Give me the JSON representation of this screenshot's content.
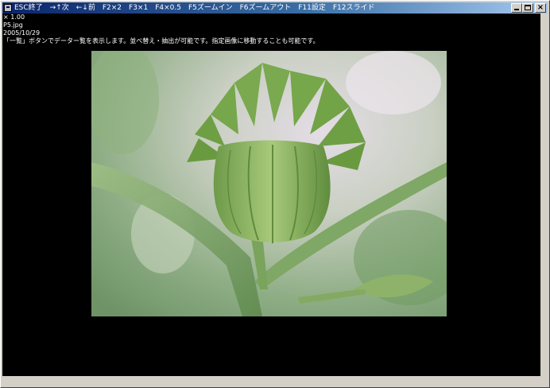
{
  "window": {
    "title": "ESC終了　→↑次　←↓前　F2×2　F3×1　F4×0.5　F5ズームイン　F6ズームアウト　F11設定　F12スライド"
  },
  "viewer": {
    "zoom": "× 1.00",
    "filename": "P5.jpg",
    "date": "2005/10/29",
    "hint": "「一覧」ボタンでデーター覧を表示します。並べ替え・抽出が可能です。指定画像に移動することも可能です。"
  },
  "colors": {
    "titlebar_start": "#0a246a",
    "titlebar_end": "#a6caf0",
    "background": "#000000",
    "text": "#ffffff"
  },
  "icons": {
    "app": "viewer-app-icon",
    "minimize": "minimize-icon",
    "maximize": "maximize-icon",
    "close": "close-icon"
  }
}
